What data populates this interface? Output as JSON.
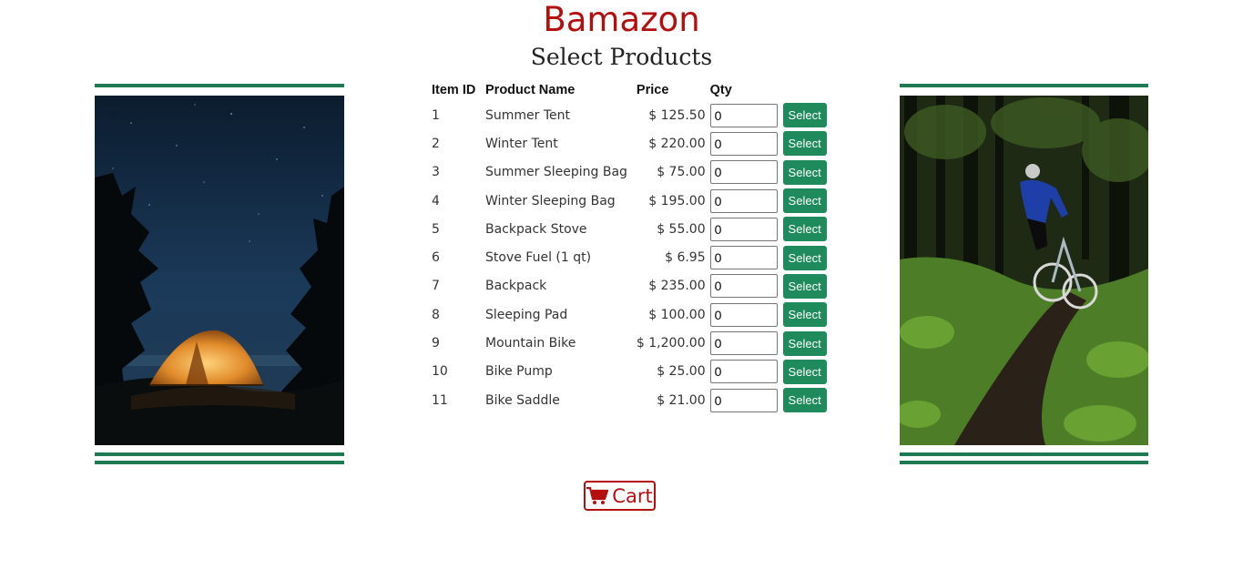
{
  "header": {
    "brand": "Bamazon",
    "subtitle": "Select Products"
  },
  "table": {
    "columns": {
      "id": "Item ID",
      "name": "Product Name",
      "price": "Price",
      "qty": "Qty"
    },
    "rows": [
      {
        "id": "1",
        "name": "Summer Tent",
        "price": "$ 125.50",
        "qty": "0",
        "action": "Select"
      },
      {
        "id": "2",
        "name": "Winter Tent",
        "price": "$ 220.00",
        "qty": "0",
        "action": "Select"
      },
      {
        "id": "3",
        "name": "Summer Sleeping Bag",
        "price": "$ 75.00",
        "qty": "0",
        "action": "Select"
      },
      {
        "id": "4",
        "name": "Winter Sleeping Bag",
        "price": "$ 195.00",
        "qty": "0",
        "action": "Select"
      },
      {
        "id": "5",
        "name": "Backpack Stove",
        "price": "$ 55.00",
        "qty": "0",
        "action": "Select"
      },
      {
        "id": "6",
        "name": "Stove Fuel (1 qt)",
        "price": "$ 6.95",
        "qty": "0",
        "action": "Select"
      },
      {
        "id": "7",
        "name": "Backpack",
        "price": "$ 235.00",
        "qty": "0",
        "action": "Select"
      },
      {
        "id": "8",
        "name": "Sleeping Pad",
        "price": "$ 100.00",
        "qty": "0",
        "action": "Select"
      },
      {
        "id": "9",
        "name": "Mountain Bike",
        "price": "$ 1,200.00",
        "qty": "0",
        "action": "Select"
      },
      {
        "id": "10",
        "name": "Bike Pump",
        "price": "$ 25.00",
        "qty": "0",
        "action": "Select"
      },
      {
        "id": "11",
        "name": "Bike Saddle",
        "price": "$ 21.00",
        "qty": "0",
        "action": "Select"
      }
    ]
  },
  "cart": {
    "label": "Cart",
    "icon": "shopping-cart-icon"
  },
  "images": {
    "left": "tent-at-night-photo",
    "right": "mountain-biker-photo"
  },
  "colors": {
    "brand": "#b30f0f",
    "accent": "#1f8a5b",
    "bar": "#1f7a53"
  }
}
